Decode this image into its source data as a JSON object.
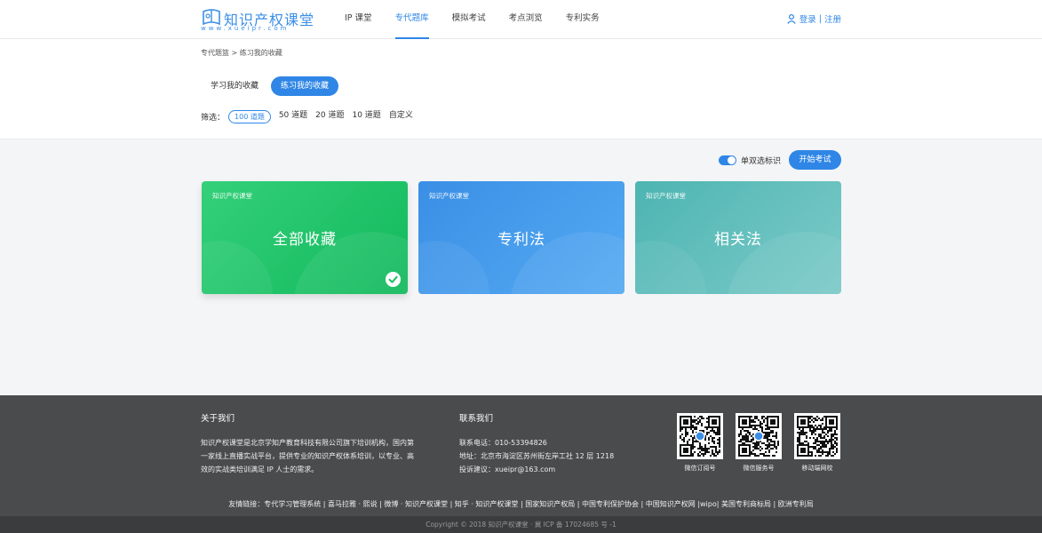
{
  "header": {
    "logo_text": "知识产权课堂",
    "logo_url": "www.xueipr.com",
    "nav": [
      "IP 课堂",
      "专代题库",
      "模拟考试",
      "考点浏览",
      "专利实务"
    ],
    "nav_active": 1,
    "login": "登录",
    "divider": "|",
    "register": "注册"
  },
  "breadcrumb": "专代题篮 > 练习我的收藏",
  "tabs": [
    "学习我的收藏",
    "练习我的收藏"
  ],
  "filter": {
    "label": "筛选：",
    "options": [
      "100 道题",
      "50 道题",
      "20 道题",
      "10 道题",
      "自定义"
    ]
  },
  "toolbar": {
    "toggle_label": "单双选标识",
    "start_button": "开始考试"
  },
  "cards": [
    {
      "brand": "知识产权课堂",
      "title": "全部收藏"
    },
    {
      "brand": "知识产权课堂",
      "title": "专利法"
    },
    {
      "brand": "知识产权课堂",
      "title": "相关法"
    }
  ],
  "footer": {
    "about_title": "关于我们",
    "about_text": "知识产权课堂是北京学知产教育科技有限公司旗下培训机构，国内第一家线上直播实战平台，提供专业的知识产权体系培训，以专业、高效的实战类培训满足 IP 人士的需求。",
    "contact_title": "联系我们",
    "phone": "联系电话：010-53394826",
    "address": "地址：北京市海淀区苏州街左岸工社 12 层 1218",
    "email": "投诉建议：xueipr@163.com",
    "qr_labels": [
      "微信订阅号",
      "微信服务号",
      "移动端网校"
    ],
    "links": "友情链接：专代学习管理系统 | 喜马拉雅 · 熙说 | 微博 · 知识产权课堂 | 知乎 · 知识产权课堂 | 国家知识产权局 | 中国专利保护协会 | 中国知识产权网 |wipo| 美国专利商标局 | 欧洲专利局",
    "copyright": "Copyright © 2018 知识产权课堂 · 冀 ICP 备 17024685 号 -1"
  }
}
